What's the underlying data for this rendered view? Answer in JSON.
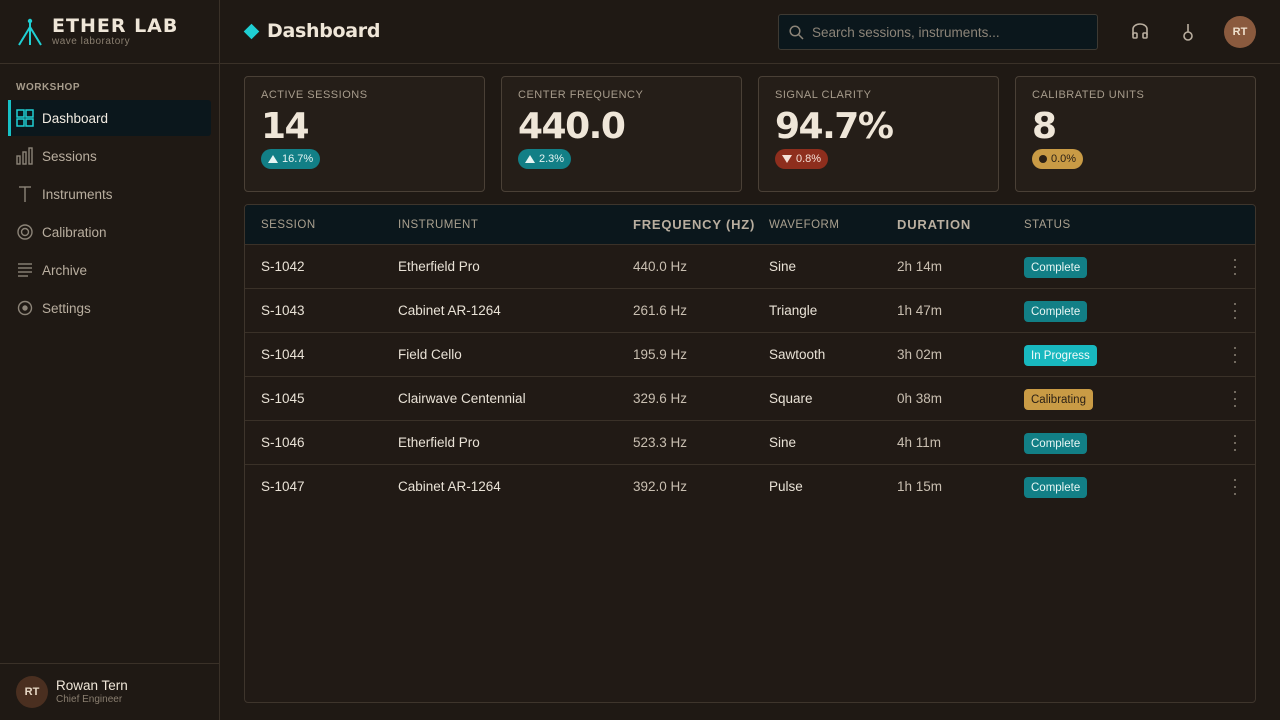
{
  "brand": {
    "name": "ETHER LAB",
    "subtitle": "wave laboratory"
  },
  "sidebar": {
    "section_label": "WORKSHOP",
    "items": [
      {
        "label": "Dashboard",
        "icon": "grid-icon",
        "active": true
      },
      {
        "label": "Sessions",
        "icon": "bars-icon",
        "active": false
      },
      {
        "label": "Instruments",
        "icon": "tuning-fork-icon",
        "active": false
      },
      {
        "label": "Calibration",
        "icon": "target-icon",
        "active": false
      },
      {
        "label": "Archive",
        "icon": "archive-icon",
        "active": false
      },
      {
        "label": "Settings",
        "icon": "gear-icon",
        "active": false
      }
    ],
    "user": {
      "initials": "RT",
      "name": "Rowan Tern",
      "role": "Chief Engineer"
    }
  },
  "header": {
    "title": "Dashboard",
    "search_placeholder": "Search sessions, instruments...",
    "avatar_initials": "RT"
  },
  "kpis": [
    {
      "label": "ACTIVE SESSIONS",
      "value": "14",
      "delta": "16.7%",
      "trend": "up"
    },
    {
      "label": "CENTER FREQUENCY",
      "value": "440.0",
      "delta": "2.3%",
      "trend": "up"
    },
    {
      "label": "SIGNAL CLARITY",
      "value": "94.7%",
      "delta": "0.8%",
      "trend": "down"
    },
    {
      "label": "CALIBRATED UNITS",
      "value": "8",
      "delta": "0.0%",
      "trend": "flat"
    }
  ],
  "table": {
    "headers": [
      "SESSION",
      "INSTRUMENT",
      "FREQUENCY (HZ)",
      "WAVEFORM",
      "DURATION",
      "STATUS"
    ],
    "rows": [
      {
        "session": "S-1042",
        "instrument": "Etherfield Pro",
        "frequency": "440.0 Hz",
        "waveform": "Sine",
        "duration": "2h 14m",
        "status": "Complete"
      },
      {
        "session": "S-1043",
        "instrument": "Cabinet AR-1264",
        "frequency": "261.6 Hz",
        "waveform": "Triangle",
        "duration": "1h 47m",
        "status": "Complete"
      },
      {
        "session": "S-1044",
        "instrument": "Field Cello",
        "frequency": "195.9 Hz",
        "waveform": "Sawtooth",
        "duration": "3h 02m",
        "status": "In Progress"
      },
      {
        "session": "S-1045",
        "instrument": "Clairwave Centennial",
        "frequency": "329.6 Hz",
        "waveform": "Square",
        "duration": "0h 38m",
        "status": "Calibrating"
      },
      {
        "session": "S-1046",
        "instrument": "Etherfield Pro",
        "frequency": "523.3 Hz",
        "waveform": "Sine",
        "duration": "4h 11m",
        "status": "Complete"
      },
      {
        "session": "S-1047",
        "instrument": "Cabinet AR-1264",
        "frequency": "392.0 Hz",
        "waveform": "Pulse",
        "duration": "1h 15m",
        "status": "Complete"
      }
    ]
  },
  "colors": {
    "accent": "#18c1c6",
    "complete": "#127f86",
    "progress": "#18b8bf",
    "calibrating": "#c99b45",
    "down": "#8e2e1d"
  }
}
